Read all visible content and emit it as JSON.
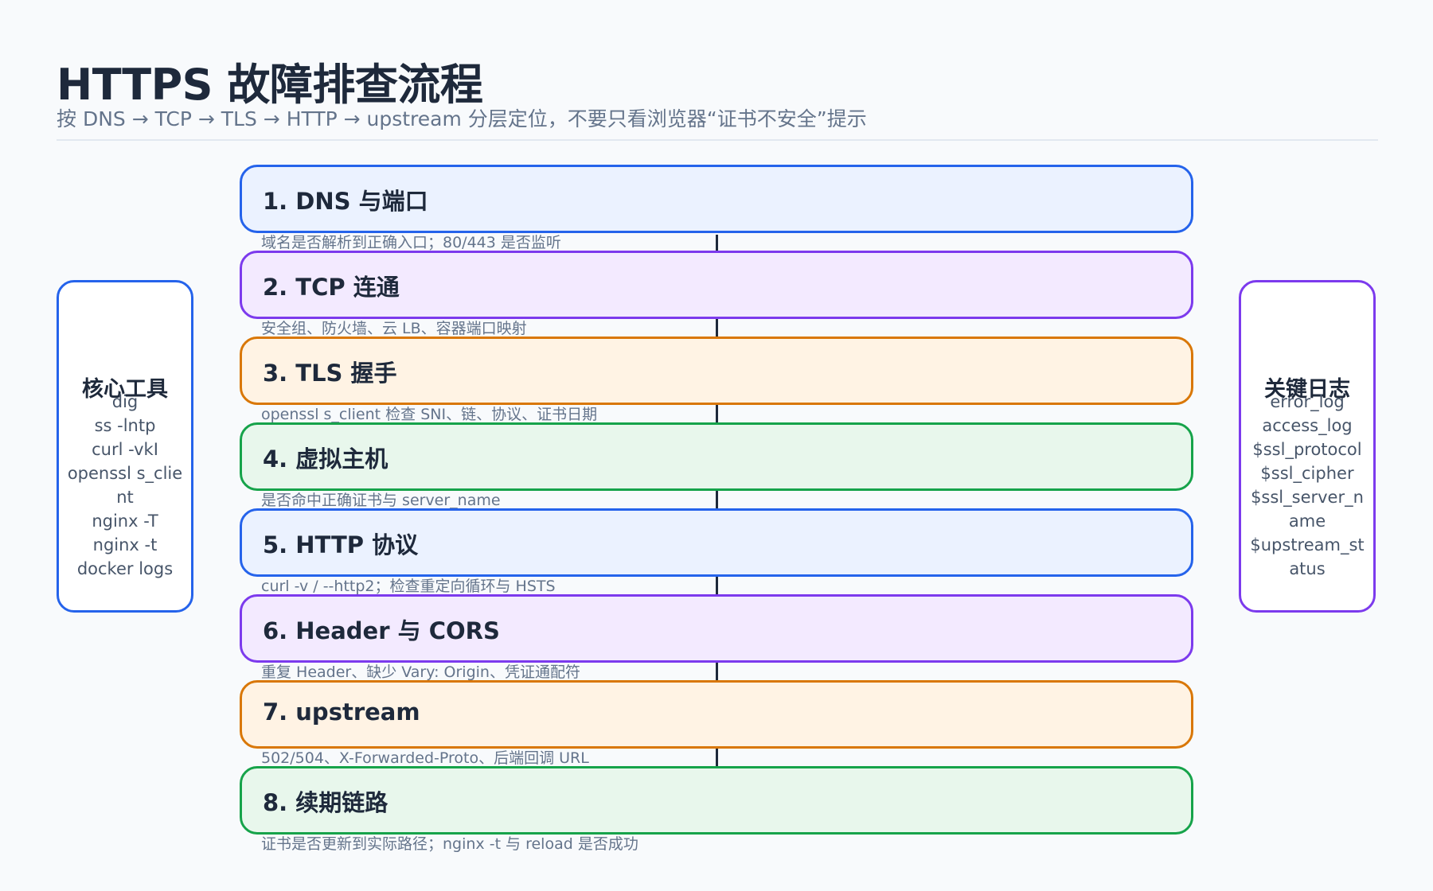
{
  "header": {
    "title": "HTTPS 故障排查流程",
    "subtitle": "按 DNS → TCP → TLS → HTTP → upstream 分层定位，不要只看浏览器“证书不安全”提示"
  },
  "steps": [
    {
      "title": "1. DNS 与端口",
      "desc": "域名是否解析到正确入口；80/443 是否监听",
      "color": "#2563eb"
    },
    {
      "title": "2. TCP 连通",
      "desc": "安全组、防火墙、云 LB、容器端口映射",
      "color": "#7c3aed"
    },
    {
      "title": "3. TLS 握手",
      "desc": "openssl s_client 检查 SNI、链、协议、证书日期",
      "color": "#d97706"
    },
    {
      "title": "4. 虚拟主机",
      "desc": "是否命中正确证书与 server_name",
      "color": "#16a34a"
    },
    {
      "title": "5. HTTP 协议",
      "desc": "curl -v / --http2；检查重定向循环与 HSTS",
      "color": "#2563eb"
    },
    {
      "title": "6. Header 与 CORS",
      "desc": "重复 Header、缺少 Vary: Origin、凭证通配符",
      "color": "#7c3aed"
    },
    {
      "title": "7. upstream",
      "desc": "502/504、X-Forwarded-Proto、后端回调 URL",
      "color": "#d97706"
    },
    {
      "title": "8. 续期链路",
      "desc": "证书是否更新到实际路径；nginx -t 与 reload 是否成功",
      "color": "#16a34a"
    }
  ],
  "tools": {
    "title": "核心工具",
    "items": [
      "dig",
      "ss -lntp",
      "curl -vkI",
      "openssl s_client",
      "nginx -T",
      "nginx -t",
      "docker logs"
    ]
  },
  "logs": {
    "title": "关键日志",
    "items": [
      "error_log",
      "access_log",
      "$ssl_protocol",
      "$ssl_cipher",
      "$ssl_server_name",
      "$upstream_status"
    ]
  }
}
